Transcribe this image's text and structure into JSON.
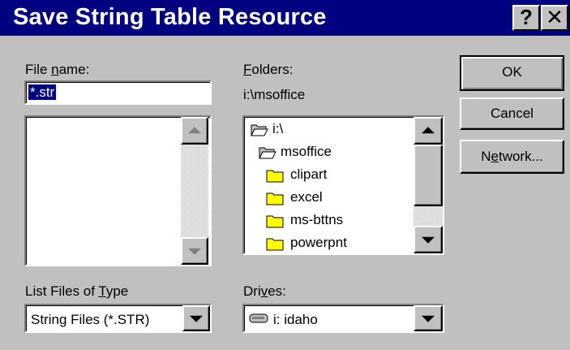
{
  "window": {
    "title": "Save String Table Resource",
    "help_glyph": "?",
    "close_glyph": "✕"
  },
  "file_name": {
    "label_before": "File ",
    "label_accel": "n",
    "label_after": "ame:",
    "value": "*.str"
  },
  "folders": {
    "label_accel": "F",
    "label_after": "olders:",
    "current_path": "i:\\msoffice",
    "items": [
      {
        "label": "i:\\",
        "icon": "open-folder-icon",
        "indent": 0
      },
      {
        "label": "msoffice",
        "icon": "open-folder-icon",
        "indent": 1
      },
      {
        "label": "clipart",
        "icon": "folder-icon",
        "indent": 2
      },
      {
        "label": "excel",
        "icon": "folder-icon",
        "indent": 2
      },
      {
        "label": "ms-bttns",
        "icon": "folder-icon",
        "indent": 2
      },
      {
        "label": "powerpnt",
        "icon": "folder-icon",
        "indent": 2
      }
    ]
  },
  "file_type": {
    "label_before": "List Files of ",
    "label_accel": "T",
    "label_after": "ype",
    "value": "String Files (*.STR)"
  },
  "drives": {
    "label_before": "Dri",
    "label_accel": "v",
    "label_after": "es:",
    "value": "i: idaho",
    "icon": "drive-icon"
  },
  "buttons": {
    "ok": "OK",
    "cancel": "Cancel",
    "network_before": "N",
    "network_accel": "e",
    "network_after": "twork..."
  },
  "colors": {
    "titlebar": "#000080",
    "face": "#c0c0c0",
    "folder": "#ffff00"
  }
}
